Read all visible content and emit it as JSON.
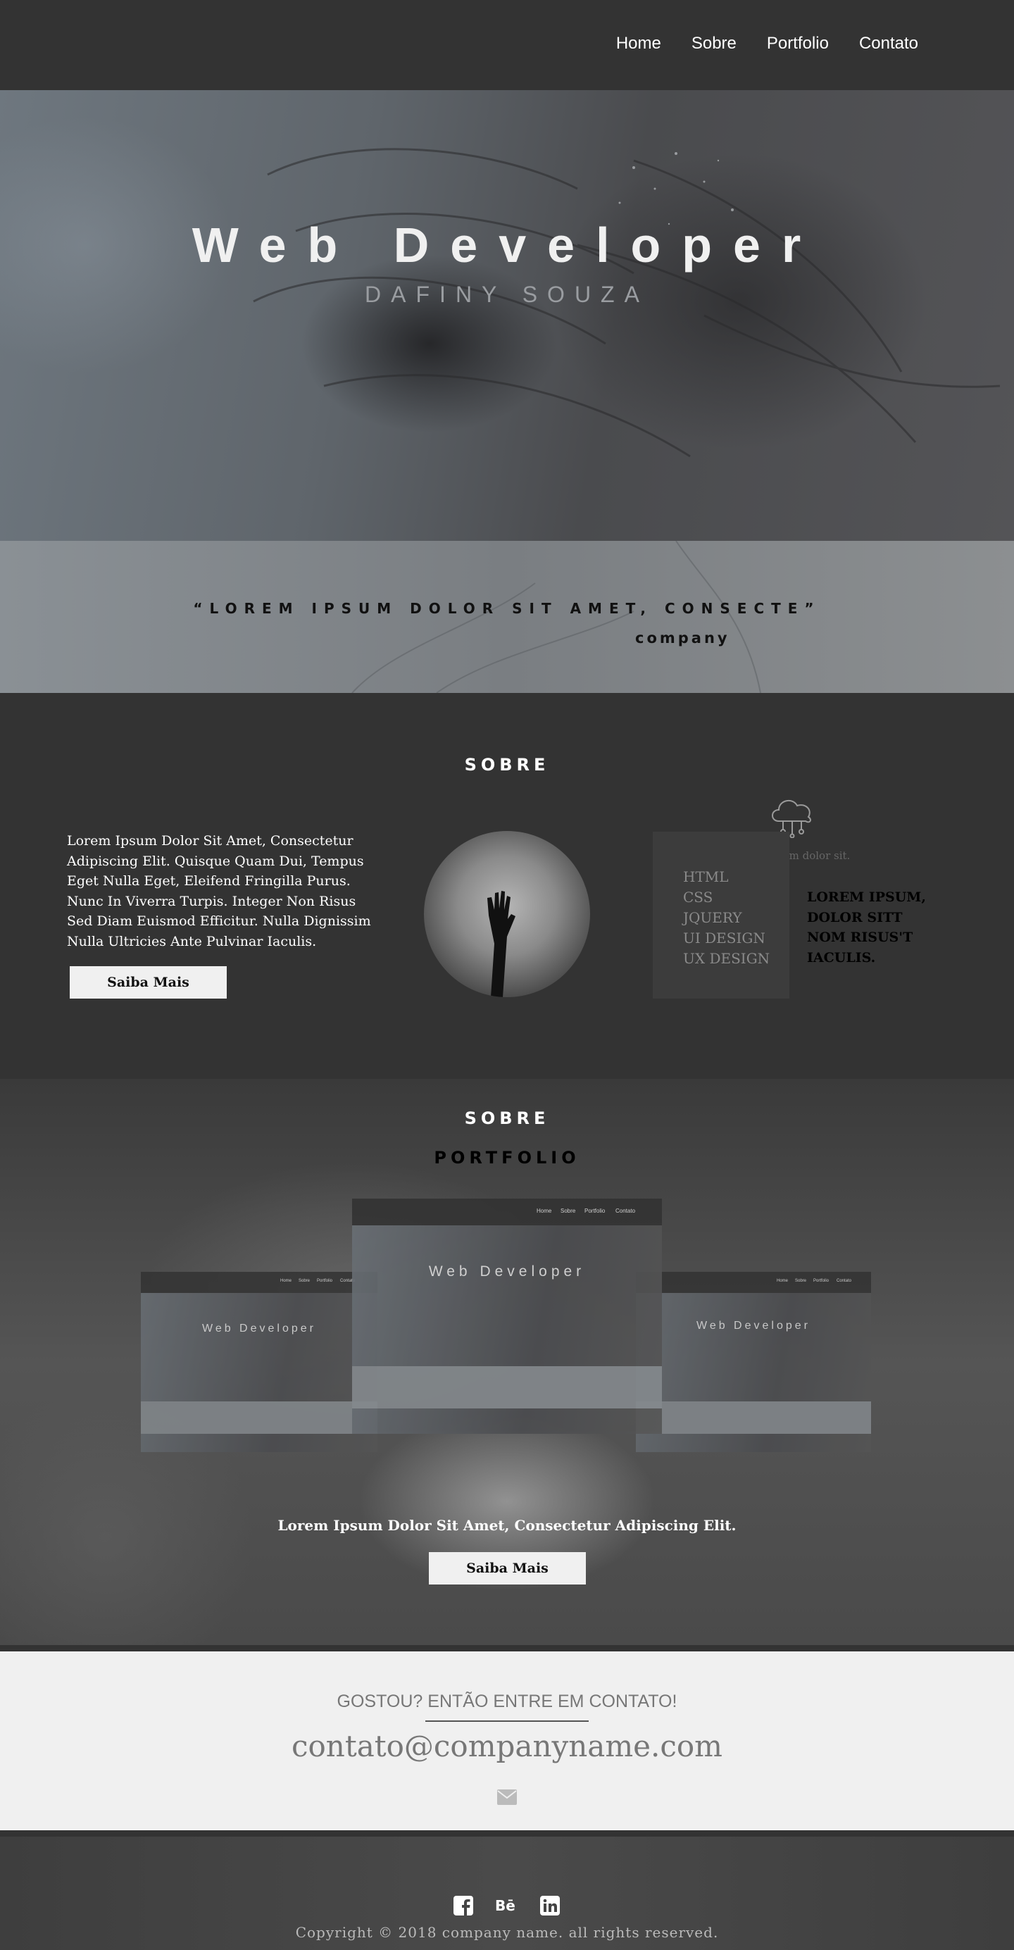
{
  "nav": {
    "items": [
      "Home",
      "Sobre",
      "Portfolio",
      "Contato"
    ]
  },
  "hero": {
    "title": "Web Developer",
    "subtitle": "DAFINY SOUZA"
  },
  "quote": {
    "text": "“LOREM IPSUM DOLOR SIT AMET, CONSECTE”",
    "author": "company"
  },
  "sobre": {
    "title": "SOBRE",
    "text": "Lorem Ipsum Dolor Sit Amet, Consectetur Adipiscing Elit. Quisque Quam Dui, Tempus Eget Nulla Eget, Eleifend Fringilla Purus. Nunc In Viverra Turpis. Integer Non Risus Sed Diam Euismod Efficitur. Nulla Dignissim Nulla Ultricies Ante Pulvinar Iaculis.",
    "button": "Saiba Mais",
    "faint_text": "lorem ipsum dolor sit.",
    "skills": [
      "HTML",
      "CSS",
      "JQUERY",
      "UI DESIGN",
      "UX DESIGN"
    ],
    "side_text": "LOREM IPSUM, DOLOR SITT NOM RISUS'T IACULIS."
  },
  "portfolio": {
    "label": "SOBRE",
    "title": "PORTFOLIO",
    "caption": "Lorem Ipsum Dolor Sit Amet, Consectetur Adipiscing Elit.",
    "button": "Saiba Mais",
    "mock": {
      "title": "Web Developer",
      "nav": [
        "Home",
        "Sobre",
        "Portfolio",
        "Contato"
      ]
    }
  },
  "contact": {
    "heading": "GOSTOU? ENTÃO ENTRE EM CONTATO!",
    "email": "contato@companyname.com"
  },
  "footer": {
    "copyright": "Copyright © 2018 company name. all rights reserved."
  },
  "icons": [
    "cloud-circuit-icon",
    "envelope-icon",
    "facebook-icon",
    "behance-icon",
    "linkedin-icon"
  ]
}
